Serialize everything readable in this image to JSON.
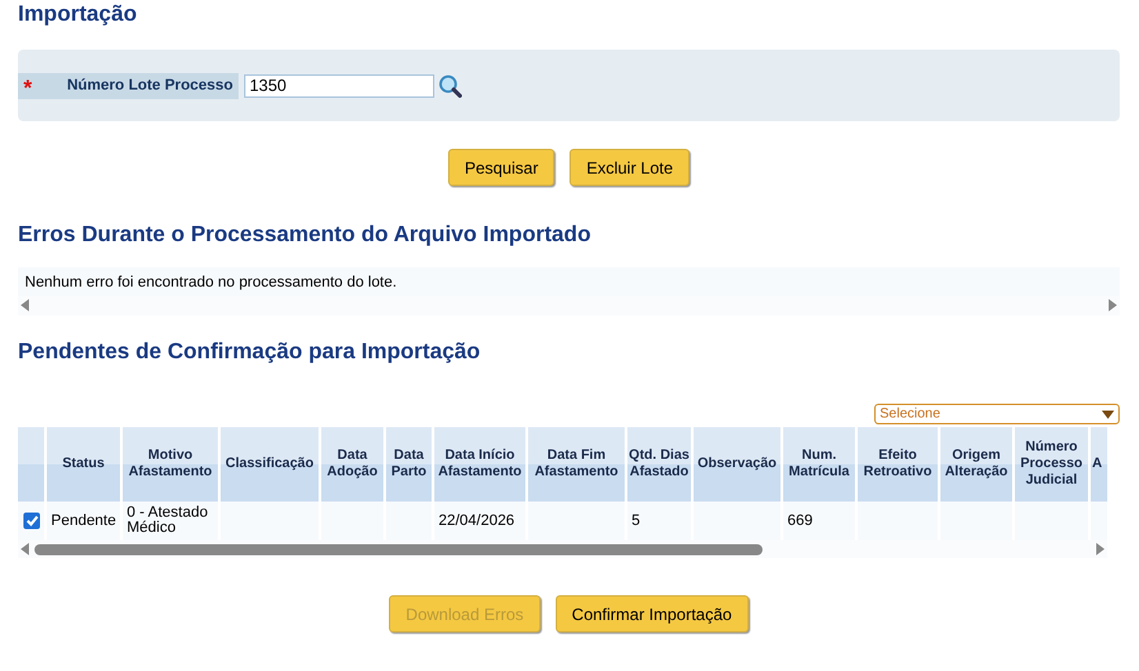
{
  "title": "Importação",
  "filter": {
    "required_mark": "*",
    "label": "Número Lote Processo",
    "value": "1350"
  },
  "actions": [
    {
      "label": "Pesquisar",
      "disabled": false
    },
    {
      "label": "Excluir Lote",
      "disabled": false
    }
  ],
  "errors_section": {
    "title": "Erros Durante o Processamento do Arquivo Importado",
    "message": "Nenhum erro foi encontrado no processamento do lote."
  },
  "pending_section": {
    "title": "Pendentes de Confirmação para Importação",
    "column_select": {
      "value": "Selecione"
    },
    "table": {
      "columns": [
        "",
        "Status",
        "Motivo Afastamento",
        "Classificação",
        "Data Adoção",
        "Data Parto",
        "Data Início Afastamento",
        "Data Fim Afastamento",
        "Qtd. Dias Afastado",
        "Observação",
        "Num. Matrícula",
        "Efeito Retroativo",
        "Origem Alteração",
        "Número Processo Judicial",
        "A"
      ],
      "rows": [
        {
          "checked": true,
          "cells": [
            "",
            "Pendente",
            "0 - Atestado Médico",
            "",
            "",
            "",
            "22/04/2026",
            "",
            "5",
            "",
            "669",
            "",
            "",
            "",
            ""
          ]
        }
      ]
    }
  },
  "footer_actions": [
    {
      "label": "Download Erros",
      "disabled": true
    },
    {
      "label": "Confirmar Importação",
      "disabled": false
    }
  ]
}
